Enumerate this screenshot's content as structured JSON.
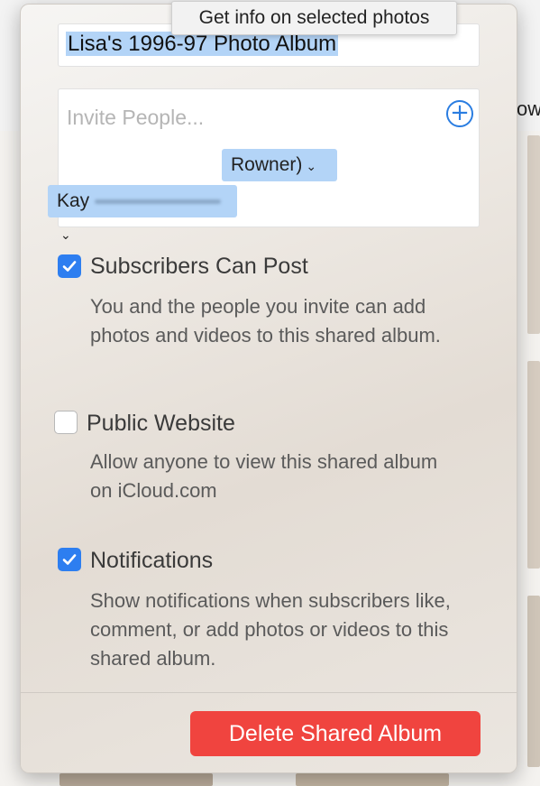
{
  "tooltip": "Get info on selected photos",
  "album_title": "Lisa's 1996-97 Photo Album",
  "invite": {
    "placeholder": "Invite People...",
    "people": [
      {
        "label": "Rowner)",
        "chevron": "⌄"
      },
      {
        "label": "Kay",
        "chevron": "⌄"
      }
    ]
  },
  "background_text": "ow",
  "options": [
    {
      "label": "Subscribers Can Post",
      "checked": true,
      "description": "You and the people you invite can add photos and videos to this shared album."
    },
    {
      "label": "Public Website",
      "checked": false,
      "description": "Allow anyone to view this shared album on iCloud.com"
    },
    {
      "label": "Notifications",
      "checked": true,
      "description": "Show notifications when subscribers like, comment, or add photos or videos to this shared album."
    }
  ],
  "delete_button": "Delete Shared Album",
  "colors": {
    "accent": "#2d7ef0",
    "destructive": "#f0443f",
    "selection": "#b3d4f7"
  },
  "icons": {
    "add": "plus-circle-icon",
    "check": "checkmark-icon",
    "dropdown": "chevron-down-icon"
  }
}
